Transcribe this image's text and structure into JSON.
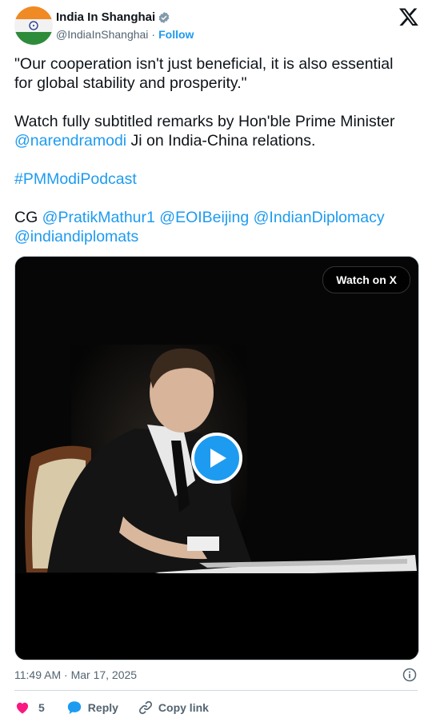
{
  "account": {
    "display_name": "India In Shanghai",
    "handle": "@IndiaInShanghai",
    "separator": "·",
    "follow_label": "Follow"
  },
  "tweet": {
    "p1": "\"Our cooperation isn't just beneficial, it is also essential for global stability and prosperity.\"",
    "p2_prefix": "Watch fully subtitled remarks by Hon'ble Prime Minister ",
    "p2_mention": "@narendramodi",
    "p2_suffix": " Ji on India-China relations.",
    "hashtag": "#PMModiPodcast",
    "cg_prefix": "CG ",
    "mentions": [
      "@PratikMathur1",
      "@EOIBeijing",
      "@IndianDiplomacy",
      "@indiandiplomats"
    ]
  },
  "media": {
    "watch_label": "Watch on X"
  },
  "meta": {
    "time": "11:49 AM",
    "separator": "·",
    "date": "Mar 17, 2025"
  },
  "actions": {
    "likes": "5",
    "reply_label": "Reply",
    "copy_label": "Copy link"
  },
  "colors": {
    "accent": "#1d9bf0",
    "like": "#f91880",
    "text": "#0f1419",
    "muted": "#536471"
  },
  "icons": [
    "avatar-flag",
    "verified-badge-icon",
    "x-logo-icon",
    "play-icon",
    "info-icon",
    "heart-icon",
    "reply-icon",
    "link-icon"
  ]
}
